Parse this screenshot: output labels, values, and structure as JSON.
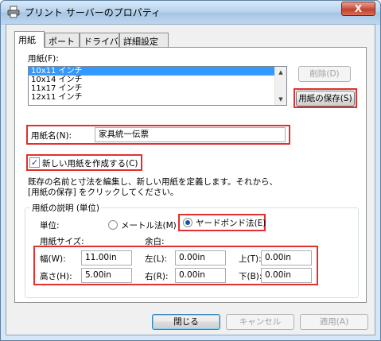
{
  "window": {
    "title": "プリント サーバーのプロパティ",
    "close_label": "X"
  },
  "tabs": [
    {
      "label": "用紙"
    },
    {
      "label": "ポート"
    },
    {
      "label": "ドライバ"
    },
    {
      "label": "詳細設定"
    }
  ],
  "paper": {
    "list_label": "用紙(F):",
    "items": [
      "10x11 インチ",
      "10x14 インチ",
      "11x17 インチ",
      "12x11 インチ"
    ],
    "selected_index": 0,
    "delete_button": "削除(D)",
    "save_button": "用紙の保存(S)",
    "name_label": "用紙名(N):",
    "name_value": "家具統一伝票",
    "new_form_checkbox": "新しい用紙を作成する(C)",
    "new_form_checked": true,
    "description_line1": "既存の名前と寸法を編集し、新しい用紙を定義します。それから、",
    "description_line2": "[用紙の保存] をクリックしてください。"
  },
  "description_group": {
    "title": "用紙の説明 (単位)",
    "units_label": "単位:",
    "unit_metric": "メートル法(M)",
    "unit_imperial": "ヤードポンド法(E)",
    "selected_unit": "imperial",
    "paper_size_label": "用紙サイズ:",
    "margins_label": "余白:",
    "width_label": "幅(W):",
    "width_value": "11.00in",
    "height_label": "高さ(H):",
    "height_value": "5.00in",
    "left_label": "左(L):",
    "left_value": "0.00in",
    "right_label": "右(R):",
    "right_value": "0.00in",
    "top_label": "上(T):",
    "top_value": "0.00in",
    "bottom_label": "下(B):",
    "bottom_value": "0.00in"
  },
  "footer": {
    "close_button": "閉じる",
    "cancel_button": "キャンセル",
    "apply_button": "適用(A)"
  },
  "colors": {
    "highlight_border": "#e0302f",
    "selection": "#3399ff"
  }
}
